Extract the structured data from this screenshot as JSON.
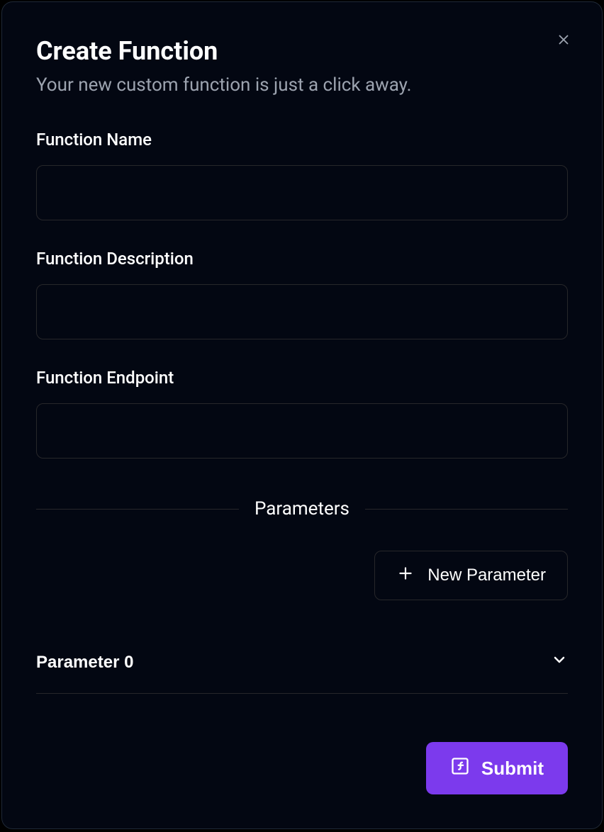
{
  "dialog": {
    "title": "Create Function",
    "subtitle": "Your new custom function is just a click away."
  },
  "form": {
    "name": {
      "label": "Function Name",
      "value": ""
    },
    "description": {
      "label": "Function Description",
      "value": ""
    },
    "endpoint": {
      "label": "Function Endpoint",
      "value": ""
    }
  },
  "parameters": {
    "divider_label": "Parameters",
    "new_button_label": "New Parameter",
    "items": [
      {
        "label": "Parameter 0"
      }
    ]
  },
  "footer": {
    "submit_label": "Submit"
  }
}
